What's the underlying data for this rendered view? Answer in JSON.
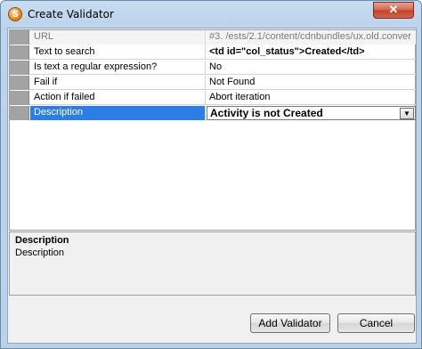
{
  "window": {
    "title": "Create Validator",
    "app_icon_glyph": "S",
    "close_glyph": "✕"
  },
  "properties": [
    {
      "name": "URL",
      "value": "#3. /ests/2.1/content/cdnbundles/ux.old.conver"
    },
    {
      "name": "Text to search",
      "value": "<td id=\"col_status\">Created</td>"
    },
    {
      "name": "Is text a regular expression?",
      "value": "No"
    },
    {
      "name": "Fail if",
      "value": "Not Found"
    },
    {
      "name": "Action if failed",
      "value": "Abort iteration"
    },
    {
      "name": "Description",
      "value": "Activity is not Created"
    }
  ],
  "description_panel": {
    "title": "Description",
    "body": "Description"
  },
  "buttons": {
    "add": "Add Validator",
    "cancel": "Cancel"
  },
  "colors": {
    "selection": "#2c7ee6",
    "gutter": "#a3a3a3"
  }
}
